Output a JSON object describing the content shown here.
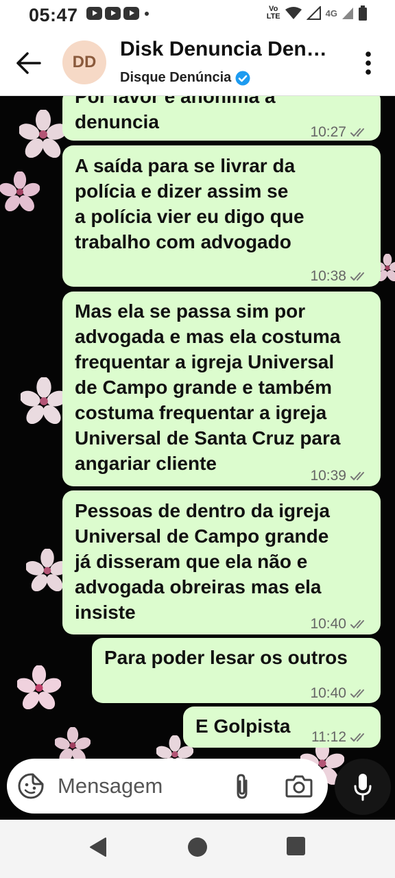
{
  "status_bar": {
    "time": "05:47",
    "volte_top": "Vo",
    "volte_bottom": "LTE",
    "network": "4G"
  },
  "header": {
    "avatar_initials": "DD",
    "title": "Disk Denuncia Den…",
    "subtitle": "Disque Denúncia",
    "verified_icon": "verified-check-icon",
    "back_icon": "arrow-left-icon",
    "menu_icon": "more-vertical-icon"
  },
  "messages": [
    {
      "lines": [
        "Por favor é anônima a",
        "denuncia"
      ],
      "time": "10:27"
    },
    {
      "lines": [
        "A saída para se livrar da",
        "polícia e dizer assim se",
        "a polícia vier eu digo que",
        "trabalho com advogado"
      ],
      "time": "10:38"
    },
    {
      "lines": [
        "Mas ela se passa sim por",
        "advogada e mas ela costuma",
        "frequentar a igreja Universal",
        "de Campo grande e também",
        "costuma frequentar a igreja",
        "Universal de Santa Cruz para",
        "angariar cliente"
      ],
      "time": "10:39"
    },
    {
      "lines": [
        "Pessoas de dentro da igreja",
        "Universal de Campo grande",
        "já disseram que ela não e",
        "advogada obreiras mas ela",
        "insiste"
      ],
      "time": "10:40"
    },
    {
      "lines": [
        "Para poder lesar os outros"
      ],
      "time": "10:40"
    },
    {
      "lines": [
        "E Golpista"
      ],
      "time": "11:12"
    }
  ],
  "composer": {
    "placeholder": "Mensagem",
    "emoji_icon": "sticker-icon",
    "attach_icon": "paperclip-icon",
    "camera_icon": "camera-icon",
    "mic_icon": "microphone-icon"
  },
  "colors": {
    "bubble": "#dcfcce",
    "chat_background": "#050505",
    "verified": "#1d9bf0"
  }
}
